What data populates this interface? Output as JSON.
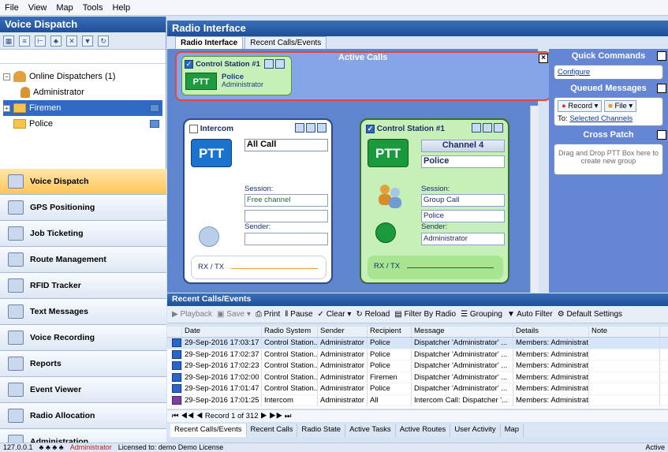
{
  "menu": [
    "File",
    "View",
    "Map",
    "Tools",
    "Help"
  ],
  "left": {
    "title": "Voice Dispatch",
    "tree": {
      "root": "Online Dispatchers (1)",
      "child": "Administrator",
      "groups": [
        "Firemen",
        "Police"
      ]
    },
    "grip": "..........",
    "nav": [
      "Voice Dispatch",
      "GPS Positioning",
      "Job Ticketing",
      "Route Management",
      "RFID Tracker",
      "Text Messages",
      "Voice Recording",
      "Reports",
      "Event Viewer",
      "Radio Allocation",
      "Administration"
    ]
  },
  "main": {
    "title": "Radio Interface",
    "tabs": [
      "Radio Interface",
      "Recent Calls/Events"
    ],
    "active_calls": {
      "title": "Active Calls",
      "card": {
        "name": "Control Station #1",
        "ptt": "PTT",
        "group": "Police",
        "user": "Administrator"
      }
    },
    "intercom": {
      "name": "Intercom",
      "ptt": "PTT",
      "target": "All Call",
      "session_label": "Session:",
      "session_value": "Free channel",
      "sender_label": "Sender:",
      "rxtx": "RX / TX"
    },
    "control_station": {
      "name": "Control Station #1",
      "ptt": "PTT",
      "channel": "Channel 4",
      "select": "Police",
      "session_label": "Session:",
      "session_value": "Group Call",
      "session_group": "Police",
      "sender_label": "Sender:",
      "sender_value": "Administrator",
      "rxtx": "RX / TX"
    }
  },
  "side": {
    "quick_commands": "Quick Commands",
    "configure": "Configure",
    "queued_messages": "Queued Messages",
    "record": "Record",
    "file": "File",
    "to_label": "To:",
    "to_value": "Selected Channels",
    "cross_patch": "Cross Patch",
    "drag_hint": "Drag and Drop PTT Box here to create new group"
  },
  "grid": {
    "title": "Recent Calls/Events",
    "toolbar": [
      "Playback",
      "Save",
      "Print",
      "Pause",
      "Clear",
      "Reload",
      "Filter By Radio",
      "Grouping",
      "Auto Filter",
      "Default Settings"
    ],
    "columns": [
      "Date",
      "Radio System",
      "Sender",
      "Recipient",
      "Message",
      "Details",
      "Note"
    ],
    "rows": [
      [
        "29-Sep-2016 17:03:17",
        "Control Station...",
        "Administrator",
        "Police",
        "Dispatcher 'Administrator' ...",
        "Members: Administrator",
        ""
      ],
      [
        "29-Sep-2016 17:02:37",
        "Control Station...",
        "Administrator",
        "Police",
        "Dispatcher 'Administrator' ...",
        "Members: Administrator",
        ""
      ],
      [
        "29-Sep-2016 17:02:23",
        "Control Station...",
        "Administrator",
        "Police",
        "Dispatcher 'Administrator' ...",
        "Members: Administrator",
        ""
      ],
      [
        "29-Sep-2016 17:02:00",
        "Control Station...",
        "Administrator",
        "Firemen",
        "Dispatcher 'Administrator' ...",
        "Members: Administrator",
        ""
      ],
      [
        "29-Sep-2016 17:01:47",
        "Control Station...",
        "Administrator",
        "Police",
        "Dispatcher 'Administrator' ...",
        "Members: Administrator",
        ""
      ],
      [
        "29-Sep-2016 17:01:25",
        "Intercom",
        "Administrator",
        "All",
        "Intercom Call: Dispatcher '...",
        "Members: Administrator",
        ""
      ]
    ],
    "pager": "Record 1 of 312",
    "bottom_tabs": [
      "Recent Calls/Events",
      "Recent Calls",
      "Radio State",
      "Active Tasks",
      "Active Routes",
      "User Activity",
      "Map"
    ]
  },
  "status": {
    "ip": "127.0.0.1",
    "user": "Administrator",
    "license": "Licensed to: demo Demo License",
    "state": "Active"
  }
}
